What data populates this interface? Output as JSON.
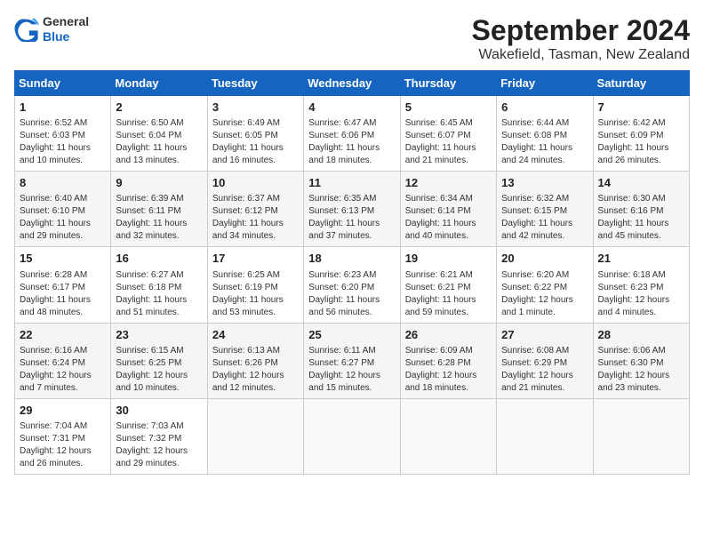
{
  "logo": {
    "general": "General",
    "blue": "Blue"
  },
  "header": {
    "month": "September 2024",
    "location": "Wakefield, Tasman, New Zealand"
  },
  "weekdays": [
    "Sunday",
    "Monday",
    "Tuesday",
    "Wednesday",
    "Thursday",
    "Friday",
    "Saturday"
  ],
  "weeks": [
    [
      {
        "day": "1",
        "info": "Sunrise: 6:52 AM\nSunset: 6:03 PM\nDaylight: 11 hours\nand 10 minutes."
      },
      {
        "day": "2",
        "info": "Sunrise: 6:50 AM\nSunset: 6:04 PM\nDaylight: 11 hours\nand 13 minutes."
      },
      {
        "day": "3",
        "info": "Sunrise: 6:49 AM\nSunset: 6:05 PM\nDaylight: 11 hours\nand 16 minutes."
      },
      {
        "day": "4",
        "info": "Sunrise: 6:47 AM\nSunset: 6:06 PM\nDaylight: 11 hours\nand 18 minutes."
      },
      {
        "day": "5",
        "info": "Sunrise: 6:45 AM\nSunset: 6:07 PM\nDaylight: 11 hours\nand 21 minutes."
      },
      {
        "day": "6",
        "info": "Sunrise: 6:44 AM\nSunset: 6:08 PM\nDaylight: 11 hours\nand 24 minutes."
      },
      {
        "day": "7",
        "info": "Sunrise: 6:42 AM\nSunset: 6:09 PM\nDaylight: 11 hours\nand 26 minutes."
      }
    ],
    [
      {
        "day": "8",
        "info": "Sunrise: 6:40 AM\nSunset: 6:10 PM\nDaylight: 11 hours\nand 29 minutes."
      },
      {
        "day": "9",
        "info": "Sunrise: 6:39 AM\nSunset: 6:11 PM\nDaylight: 11 hours\nand 32 minutes."
      },
      {
        "day": "10",
        "info": "Sunrise: 6:37 AM\nSunset: 6:12 PM\nDaylight: 11 hours\nand 34 minutes."
      },
      {
        "day": "11",
        "info": "Sunrise: 6:35 AM\nSunset: 6:13 PM\nDaylight: 11 hours\nand 37 minutes."
      },
      {
        "day": "12",
        "info": "Sunrise: 6:34 AM\nSunset: 6:14 PM\nDaylight: 11 hours\nand 40 minutes."
      },
      {
        "day": "13",
        "info": "Sunrise: 6:32 AM\nSunset: 6:15 PM\nDaylight: 11 hours\nand 42 minutes."
      },
      {
        "day": "14",
        "info": "Sunrise: 6:30 AM\nSunset: 6:16 PM\nDaylight: 11 hours\nand 45 minutes."
      }
    ],
    [
      {
        "day": "15",
        "info": "Sunrise: 6:28 AM\nSunset: 6:17 PM\nDaylight: 11 hours\nand 48 minutes."
      },
      {
        "day": "16",
        "info": "Sunrise: 6:27 AM\nSunset: 6:18 PM\nDaylight: 11 hours\nand 51 minutes."
      },
      {
        "day": "17",
        "info": "Sunrise: 6:25 AM\nSunset: 6:19 PM\nDaylight: 11 hours\nand 53 minutes."
      },
      {
        "day": "18",
        "info": "Sunrise: 6:23 AM\nSunset: 6:20 PM\nDaylight: 11 hours\nand 56 minutes."
      },
      {
        "day": "19",
        "info": "Sunrise: 6:21 AM\nSunset: 6:21 PM\nDaylight: 11 hours\nand 59 minutes."
      },
      {
        "day": "20",
        "info": "Sunrise: 6:20 AM\nSunset: 6:22 PM\nDaylight: 12 hours\nand 1 minute."
      },
      {
        "day": "21",
        "info": "Sunrise: 6:18 AM\nSunset: 6:23 PM\nDaylight: 12 hours\nand 4 minutes."
      }
    ],
    [
      {
        "day": "22",
        "info": "Sunrise: 6:16 AM\nSunset: 6:24 PM\nDaylight: 12 hours\nand 7 minutes."
      },
      {
        "day": "23",
        "info": "Sunrise: 6:15 AM\nSunset: 6:25 PM\nDaylight: 12 hours\nand 10 minutes."
      },
      {
        "day": "24",
        "info": "Sunrise: 6:13 AM\nSunset: 6:26 PM\nDaylight: 12 hours\nand 12 minutes."
      },
      {
        "day": "25",
        "info": "Sunrise: 6:11 AM\nSunset: 6:27 PM\nDaylight: 12 hours\nand 15 minutes."
      },
      {
        "day": "26",
        "info": "Sunrise: 6:09 AM\nSunset: 6:28 PM\nDaylight: 12 hours\nand 18 minutes."
      },
      {
        "day": "27",
        "info": "Sunrise: 6:08 AM\nSunset: 6:29 PM\nDaylight: 12 hours\nand 21 minutes."
      },
      {
        "day": "28",
        "info": "Sunrise: 6:06 AM\nSunset: 6:30 PM\nDaylight: 12 hours\nand 23 minutes."
      }
    ],
    [
      {
        "day": "29",
        "info": "Sunrise: 7:04 AM\nSunset: 7:31 PM\nDaylight: 12 hours\nand 26 minutes."
      },
      {
        "day": "30",
        "info": "Sunrise: 7:03 AM\nSunset: 7:32 PM\nDaylight: 12 hours\nand 29 minutes."
      },
      {
        "day": "",
        "info": ""
      },
      {
        "day": "",
        "info": ""
      },
      {
        "day": "",
        "info": ""
      },
      {
        "day": "",
        "info": ""
      },
      {
        "day": "",
        "info": ""
      }
    ]
  ]
}
